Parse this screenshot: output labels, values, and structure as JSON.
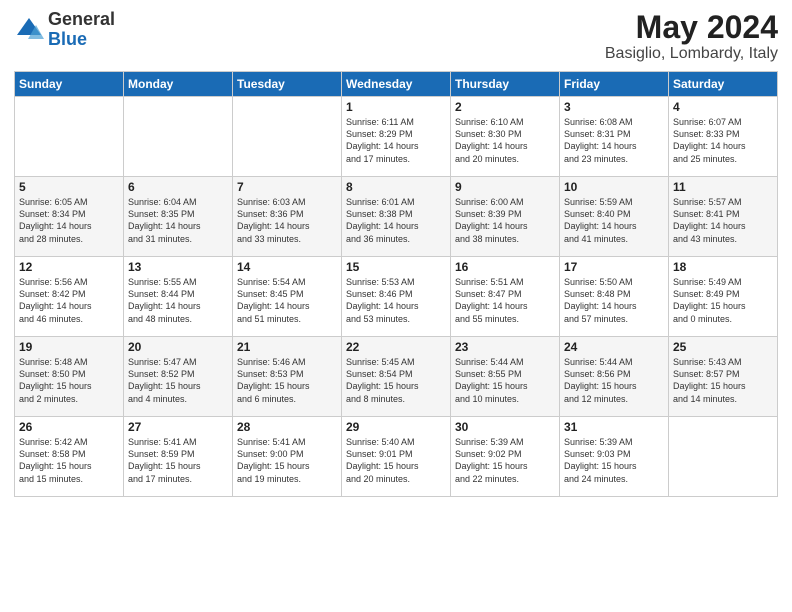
{
  "logo": {
    "general": "General",
    "blue": "Blue"
  },
  "title": "May 2024",
  "location": "Basiglio, Lombardy, Italy",
  "days_of_week": [
    "Sunday",
    "Monday",
    "Tuesday",
    "Wednesday",
    "Thursday",
    "Friday",
    "Saturday"
  ],
  "weeks": [
    [
      {
        "day": "",
        "info": ""
      },
      {
        "day": "",
        "info": ""
      },
      {
        "day": "",
        "info": ""
      },
      {
        "day": "1",
        "info": "Sunrise: 6:11 AM\nSunset: 8:29 PM\nDaylight: 14 hours\nand 17 minutes."
      },
      {
        "day": "2",
        "info": "Sunrise: 6:10 AM\nSunset: 8:30 PM\nDaylight: 14 hours\nand 20 minutes."
      },
      {
        "day": "3",
        "info": "Sunrise: 6:08 AM\nSunset: 8:31 PM\nDaylight: 14 hours\nand 23 minutes."
      },
      {
        "day": "4",
        "info": "Sunrise: 6:07 AM\nSunset: 8:33 PM\nDaylight: 14 hours\nand 25 minutes."
      }
    ],
    [
      {
        "day": "5",
        "info": "Sunrise: 6:05 AM\nSunset: 8:34 PM\nDaylight: 14 hours\nand 28 minutes."
      },
      {
        "day": "6",
        "info": "Sunrise: 6:04 AM\nSunset: 8:35 PM\nDaylight: 14 hours\nand 31 minutes."
      },
      {
        "day": "7",
        "info": "Sunrise: 6:03 AM\nSunset: 8:36 PM\nDaylight: 14 hours\nand 33 minutes."
      },
      {
        "day": "8",
        "info": "Sunrise: 6:01 AM\nSunset: 8:38 PM\nDaylight: 14 hours\nand 36 minutes."
      },
      {
        "day": "9",
        "info": "Sunrise: 6:00 AM\nSunset: 8:39 PM\nDaylight: 14 hours\nand 38 minutes."
      },
      {
        "day": "10",
        "info": "Sunrise: 5:59 AM\nSunset: 8:40 PM\nDaylight: 14 hours\nand 41 minutes."
      },
      {
        "day": "11",
        "info": "Sunrise: 5:57 AM\nSunset: 8:41 PM\nDaylight: 14 hours\nand 43 minutes."
      }
    ],
    [
      {
        "day": "12",
        "info": "Sunrise: 5:56 AM\nSunset: 8:42 PM\nDaylight: 14 hours\nand 46 minutes."
      },
      {
        "day": "13",
        "info": "Sunrise: 5:55 AM\nSunset: 8:44 PM\nDaylight: 14 hours\nand 48 minutes."
      },
      {
        "day": "14",
        "info": "Sunrise: 5:54 AM\nSunset: 8:45 PM\nDaylight: 14 hours\nand 51 minutes."
      },
      {
        "day": "15",
        "info": "Sunrise: 5:53 AM\nSunset: 8:46 PM\nDaylight: 14 hours\nand 53 minutes."
      },
      {
        "day": "16",
        "info": "Sunrise: 5:51 AM\nSunset: 8:47 PM\nDaylight: 14 hours\nand 55 minutes."
      },
      {
        "day": "17",
        "info": "Sunrise: 5:50 AM\nSunset: 8:48 PM\nDaylight: 14 hours\nand 57 minutes."
      },
      {
        "day": "18",
        "info": "Sunrise: 5:49 AM\nSunset: 8:49 PM\nDaylight: 15 hours\nand 0 minutes."
      }
    ],
    [
      {
        "day": "19",
        "info": "Sunrise: 5:48 AM\nSunset: 8:50 PM\nDaylight: 15 hours\nand 2 minutes."
      },
      {
        "day": "20",
        "info": "Sunrise: 5:47 AM\nSunset: 8:52 PM\nDaylight: 15 hours\nand 4 minutes."
      },
      {
        "day": "21",
        "info": "Sunrise: 5:46 AM\nSunset: 8:53 PM\nDaylight: 15 hours\nand 6 minutes."
      },
      {
        "day": "22",
        "info": "Sunrise: 5:45 AM\nSunset: 8:54 PM\nDaylight: 15 hours\nand 8 minutes."
      },
      {
        "day": "23",
        "info": "Sunrise: 5:44 AM\nSunset: 8:55 PM\nDaylight: 15 hours\nand 10 minutes."
      },
      {
        "day": "24",
        "info": "Sunrise: 5:44 AM\nSunset: 8:56 PM\nDaylight: 15 hours\nand 12 minutes."
      },
      {
        "day": "25",
        "info": "Sunrise: 5:43 AM\nSunset: 8:57 PM\nDaylight: 15 hours\nand 14 minutes."
      }
    ],
    [
      {
        "day": "26",
        "info": "Sunrise: 5:42 AM\nSunset: 8:58 PM\nDaylight: 15 hours\nand 15 minutes."
      },
      {
        "day": "27",
        "info": "Sunrise: 5:41 AM\nSunset: 8:59 PM\nDaylight: 15 hours\nand 17 minutes."
      },
      {
        "day": "28",
        "info": "Sunrise: 5:41 AM\nSunset: 9:00 PM\nDaylight: 15 hours\nand 19 minutes."
      },
      {
        "day": "29",
        "info": "Sunrise: 5:40 AM\nSunset: 9:01 PM\nDaylight: 15 hours\nand 20 minutes."
      },
      {
        "day": "30",
        "info": "Sunrise: 5:39 AM\nSunset: 9:02 PM\nDaylight: 15 hours\nand 22 minutes."
      },
      {
        "day": "31",
        "info": "Sunrise: 5:39 AM\nSunset: 9:03 PM\nDaylight: 15 hours\nand 24 minutes."
      },
      {
        "day": "",
        "info": ""
      }
    ]
  ]
}
